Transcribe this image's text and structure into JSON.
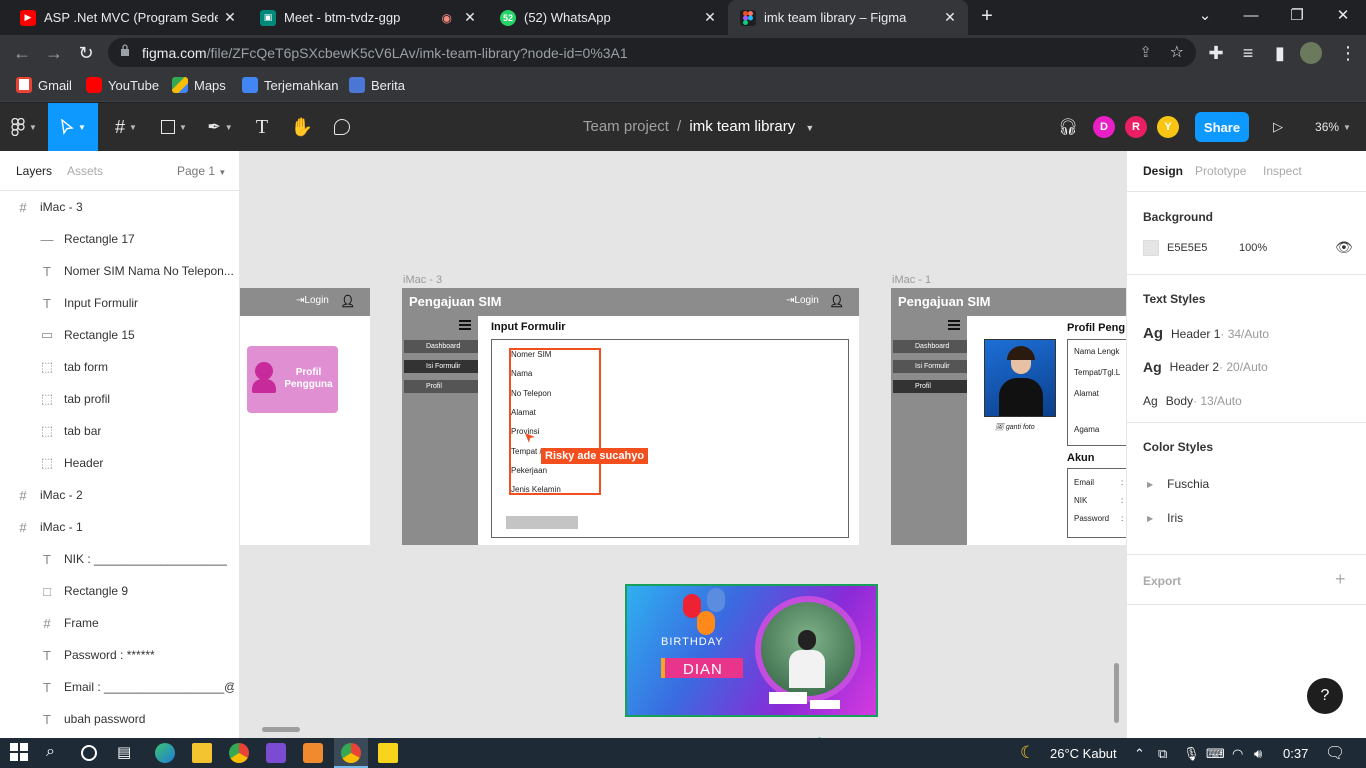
{
  "browser": {
    "tabs": [
      {
        "title": "ASP .Net MVC (Program Sederha",
        "active": false
      },
      {
        "title": "Meet - btm-tvdz-ggp",
        "active": false
      },
      {
        "title": "(52) WhatsApp",
        "active": false
      },
      {
        "title": "imk team library – Figma",
        "active": true
      }
    ],
    "url_host": "figma.com",
    "url_path": "/file/ZFcQeT6pSXcbewK5cV6LAv/imk-team-library?node-id=0%3A1",
    "bookmarks": [
      "Gmail",
      "YouTube",
      "Maps",
      "Terjemahkan",
      "Berita"
    ]
  },
  "figma": {
    "project": "Team project",
    "separator": "/",
    "file_name": "imk team library",
    "share_label": "Share",
    "zoom": "36%",
    "avatars": [
      "D",
      "R",
      "Y"
    ],
    "avatar_colors": [
      "#e91ec4",
      "#e91e63",
      "#f9c513"
    ]
  },
  "left_panel": {
    "tab_layers": "Layers",
    "tab_assets": "Assets",
    "page": "Page 1",
    "layers": [
      {
        "icon": "#",
        "name": "iMac - 3",
        "indent": 0
      },
      {
        "icon": "—",
        "name": "Rectangle 17",
        "indent": 1
      },
      {
        "icon": "T",
        "name": "Nomer SIM Nama No Telepon...",
        "indent": 1
      },
      {
        "icon": "T",
        "name": "Input Formulir",
        "indent": 1
      },
      {
        "icon": "▭",
        "name": "Rectangle 15",
        "indent": 1
      },
      {
        "icon": "⬚",
        "name": "tab form",
        "indent": 1
      },
      {
        "icon": "⬚",
        "name": "tab profil",
        "indent": 1
      },
      {
        "icon": "⬚",
        "name": "tab bar",
        "indent": 1
      },
      {
        "icon": "⬚",
        "name": "Header",
        "indent": 1
      },
      {
        "icon": "#",
        "name": "iMac - 2",
        "indent": 0
      },
      {
        "icon": "#",
        "name": "iMac - 1",
        "indent": 0
      },
      {
        "icon": "T",
        "name": "NIK : ____________________",
        "indent": 1
      },
      {
        "icon": "□",
        "name": "Rectangle 9",
        "indent": 1
      },
      {
        "icon": "#",
        "name": "Frame",
        "indent": 1
      },
      {
        "icon": "T",
        "name": "Password : ******",
        "indent": 1
      },
      {
        "icon": "T",
        "name": "Email : __________________@g...",
        "indent": 1
      },
      {
        "icon": "T",
        "name": "ubah password",
        "indent": 1
      }
    ]
  },
  "canvas": {
    "frame2": {
      "login": "Login",
      "card_line1": "Profil",
      "card_line2": "Pengguna"
    },
    "frame3": {
      "label": "iMac - 3",
      "header": "Pengajuan SIM",
      "login": "Login",
      "menu": [
        "Dashboard",
        "Isi Formulir",
        "Profil"
      ],
      "form_title": "Input Formulir",
      "fields": [
        "Nomer SIM",
        "Nama",
        "No Telepon",
        "Alamat",
        "Provinsi",
        "Tempat / Tanggal Lahir",
        "Pekerjaan",
        "Jenis Kelamin"
      ],
      "cursor_user": "Risky ade sucahyo",
      "cursor_color": "#f24e1e"
    },
    "frame1": {
      "label": "iMac - 1",
      "header": "Pengajuan SIM",
      "menu": [
        "Dashboard",
        "Isi Formulir",
        "Profil"
      ],
      "profile_title": "Profil Peng",
      "photo_caption": "ganti foto",
      "fields": [
        "Nama Lengk",
        "Tempat/Tgl.L",
        "Alamat",
        "Agama"
      ],
      "akun_title": "Akun",
      "akun_fields": [
        "Email",
        "NIK",
        "Password"
      ]
    },
    "birthday": {
      "line1": "BIRTHDAY",
      "line2": "DIAN"
    }
  },
  "right_panel": {
    "tabs": [
      "Design",
      "Prototype",
      "Inspect"
    ],
    "background_title": "Background",
    "bg_hex": "E5E5E5",
    "bg_opacity": "100%",
    "text_styles_title": "Text Styles",
    "text_styles": [
      {
        "name": "Header 1",
        "meta": " · 34/Auto"
      },
      {
        "name": "Header 2",
        "meta": " · 20/Auto"
      },
      {
        "name": "Body",
        "meta": " · 13/Auto"
      }
    ],
    "color_styles_title": "Color Styles",
    "color_styles": [
      "Fuschia",
      "Iris"
    ],
    "export_title": "Export"
  },
  "taskbar": {
    "temp": "26°C",
    "weather": "Kabut",
    "time": "0:37"
  }
}
